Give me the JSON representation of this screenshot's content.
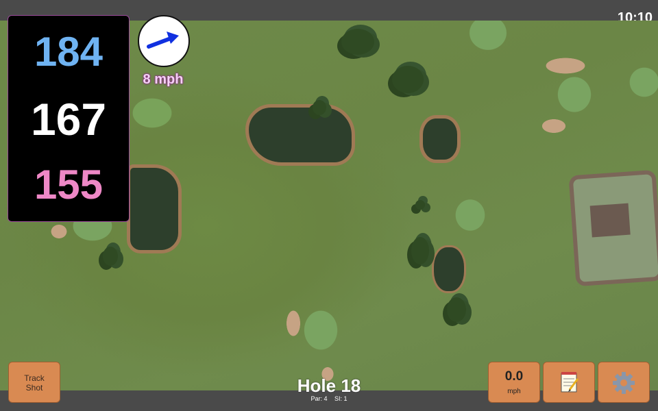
{
  "status": {
    "clock": "10:10"
  },
  "distances": {
    "back": "184",
    "middle": "167",
    "front": "155"
  },
  "wind": {
    "speed": "8 mph",
    "arrow_icon": "arrow-right-icon"
  },
  "hole": {
    "title": "Hole 18",
    "par": "Par: 4",
    "si": "SI: 1"
  },
  "buttons": {
    "track_shot": [
      "Track",
      "Shot"
    ],
    "speed_value": "0.0",
    "speed_unit": "mph",
    "notes_icon": "notepad-icon",
    "settings_icon": "gear-icon"
  },
  "colors": {
    "back": "#6fb3f2",
    "middle": "#ffffff",
    "front": "#ee88c6",
    "button": "#d98a52",
    "wind_arrow": "#1030e0"
  }
}
